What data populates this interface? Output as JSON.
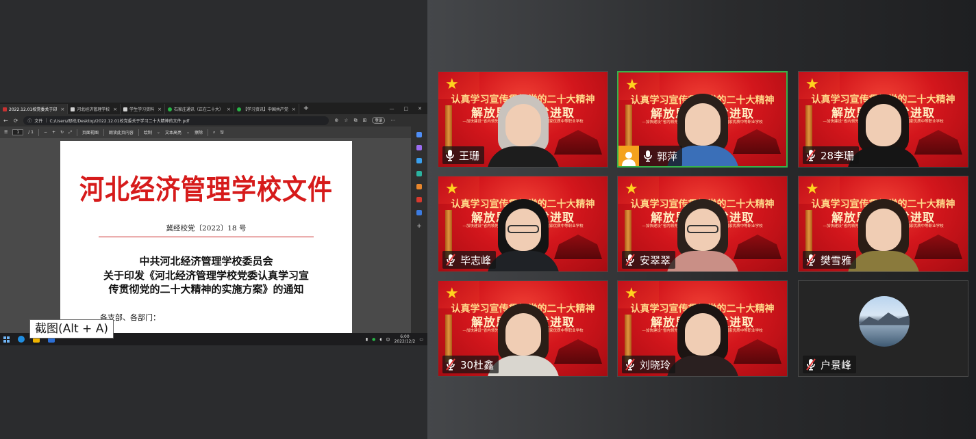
{
  "browser": {
    "tabs": [
      {
        "label": "2022.12.01校党委关于印",
        "favicon": "red",
        "active": true
      },
      {
        "label": "河北经济管理学校",
        "favicon": "white",
        "active": false
      },
      {
        "label": "学生学习资料",
        "favicon": "white",
        "active": false
      },
      {
        "label": "石家庄通讯（正在二十大）",
        "favicon": "green",
        "active": false
      },
      {
        "label": "【学习资讯】中国共产党",
        "favicon": "green",
        "active": false
      }
    ],
    "new_tab": "+",
    "url_label": "文件",
    "url": "C:/Users/邸校/Desktop/2022.12.01校党委关于学习二十大精神的文件.pdf",
    "login": "登录",
    "pdf_toolbar": {
      "page_current": "1",
      "page_total": "/ 1",
      "zoom_out": "−",
      "zoom_in": "+",
      "page_view": "页面视图",
      "read_aloud": "朗读此页内容",
      "draw": "绘制",
      "highlight": "文本高亮",
      "erase": "擦除"
    },
    "document": {
      "title": "河北经济管理学校文件",
      "doc_number": "冀经校党〔2022〕18 号",
      "heading_1": "中共河北经济管理学校委员会",
      "heading_2": "关于印发《河北经济管理学校党委认真学习宣",
      "heading_3": "传贯彻党的二十大精神的实施方案》的通知",
      "recipient": "各支部、各部门："
    },
    "clock": {
      "time": "6:00",
      "date": "2022/12/2"
    },
    "tray_lang": "中"
  },
  "tooltip": "截图(Alt + A)",
  "colors": {
    "accent_green": "#37b34a",
    "avatar_orange": "#f4a21d",
    "doc_red": "#d61b1b"
  },
  "background_slide": {
    "line1": "认真学习宣传贯彻党的二十大精神",
    "line2": "解放思想 奋发进取",
    "line3": "—加快建设“省内领先、全国知名、有特色显著”的国家优质中等职业学校"
  },
  "participants": [
    {
      "name": "王珊",
      "mic": "on",
      "video": true,
      "active": false,
      "avatar_badge": false
    },
    {
      "name": "郭萍",
      "mic": "on",
      "video": true,
      "active": true,
      "avatar_badge": true
    },
    {
      "name": "28李珊",
      "mic": "muted",
      "video": true,
      "active": false,
      "avatar_badge": false
    },
    {
      "name": "毕志峰",
      "mic": "muted",
      "video": true,
      "active": false,
      "avatar_badge": false
    },
    {
      "name": "安翠翠",
      "mic": "muted",
      "video": true,
      "active": false,
      "avatar_badge": false
    },
    {
      "name": "樊雪雅",
      "mic": "muted",
      "video": true,
      "active": false,
      "avatar_badge": false
    },
    {
      "name": "30杜鑫",
      "mic": "muted",
      "video": true,
      "active": false,
      "avatar_badge": false
    },
    {
      "name": "刘晓玲",
      "mic": "muted",
      "video": true,
      "active": false,
      "avatar_badge": false
    },
    {
      "name": "户景峰",
      "mic": "muted",
      "video": false,
      "active": false,
      "avatar_badge": false
    }
  ]
}
